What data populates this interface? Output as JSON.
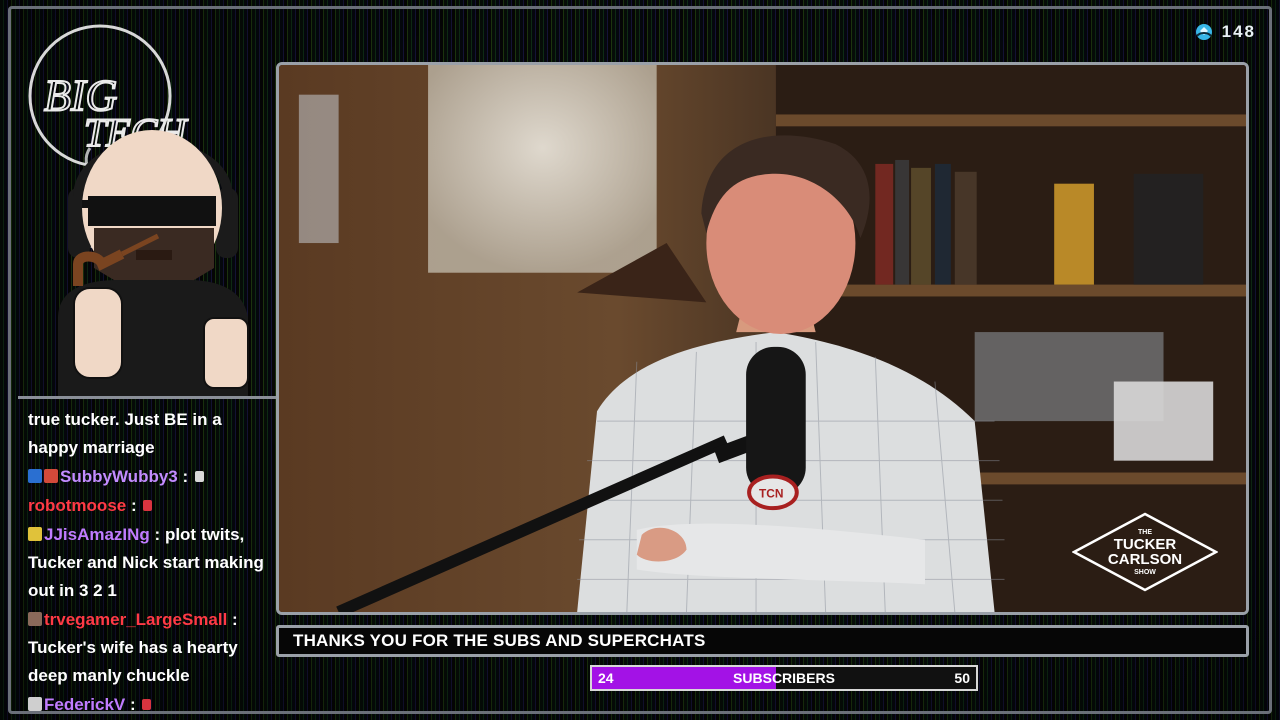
{
  "viewers": {
    "icon": "viewer-icon",
    "count": "148"
  },
  "avatar": {
    "logo_text": "BIG TECH"
  },
  "chat": [
    {
      "user": "",
      "user_color": "#ffffff",
      "message": "true tucker. Just BE in a happy marriage",
      "badges": [],
      "emote": false
    },
    {
      "user": "SubbyWubby3",
      "user_color": "#c38cff",
      "message": "",
      "badges": [
        "#2a6fd1",
        "#d24a3a"
      ],
      "emote": true,
      "emote_color": "#d9d9d9"
    },
    {
      "user": "robotmoose",
      "user_color": "#ff3a45",
      "message": "",
      "badges": [],
      "emote": true,
      "emote_color": "#d9343f"
    },
    {
      "user": "JJisAmazINg",
      "user_color": "#c07cff",
      "message": "plot twits, Tucker and Nick start making out in 3 2 1",
      "badges": [
        "#e0c23a"
      ],
      "emote": false
    },
    {
      "user": "trvegamer_LargeSmall",
      "user_color": "#ff3a45",
      "message": "Tucker's wife has a hearty deep manly chuckle",
      "badges": [
        "#8a6a5a"
      ],
      "emote": false
    },
    {
      "user": "FederickV",
      "user_color": "#c07cff",
      "message": "",
      "badges": [
        "#cfcfcf"
      ],
      "emote": true,
      "emote_color": "#d9343f"
    }
  ],
  "video": {
    "mic_logo": "TCN",
    "show_logo": {
      "line1": "THE",
      "line2": "TUCKER",
      "line3": "CARLSON",
      "line4": "SHOW"
    }
  },
  "ticker": {
    "text": "THANKS YOU FOR THE SUBS AND SUPERCHATS"
  },
  "subscribers": {
    "current": "24",
    "label": "SUBSCRIBERS",
    "goal": "50",
    "progress": 0.48,
    "fill_color": "#a312e6"
  }
}
